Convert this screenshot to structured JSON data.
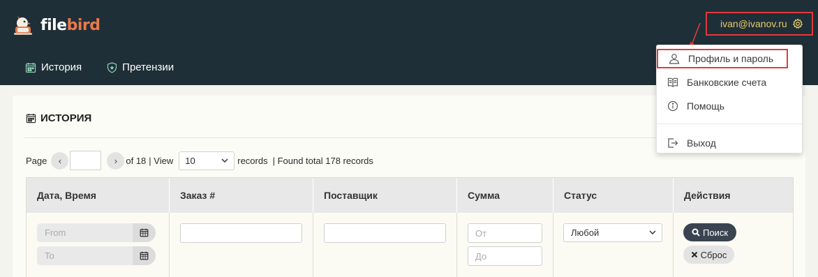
{
  "brand": {
    "logo_part1": "file",
    "logo_part2": "bird"
  },
  "user": {
    "email": "ivan@ivanov.ru"
  },
  "nav": [
    {
      "label": "История",
      "icon": "calendar-icon"
    },
    {
      "label": "Претензии",
      "icon": "shield-icon"
    }
  ],
  "user_menu": [
    {
      "label": "Профиль и пароль",
      "icon": "user-icon"
    },
    {
      "label": "Банковские счета",
      "icon": "book-icon"
    },
    {
      "label": "Помощь",
      "icon": "info-icon"
    },
    {
      "label": "Выход",
      "icon": "logout-icon"
    }
  ],
  "section": {
    "title": "ИСТОРИЯ"
  },
  "pager": {
    "page_label": "Page",
    "page_value": "",
    "of_label": "of 18",
    "view_label": "| View",
    "per_page": "10",
    "records_label": "records",
    "found_label": "| Found total 178 records"
  },
  "table": {
    "columns": [
      "Дата, Время",
      "Заказ #",
      "Поставщик",
      "Сумма",
      "Статус",
      "Действия"
    ],
    "filters": {
      "date_from_placeholder": "From",
      "date_to_placeholder": "To",
      "sum_from_placeholder": "От",
      "sum_to_placeholder": "До",
      "status_value": "Любой",
      "search_label": "Поиск",
      "reset_label": "Сброс"
    }
  },
  "colors": {
    "header_bg": "#1f2f37",
    "accent_yellow": "#e7c96b",
    "brand_orange": "#e9784c",
    "highlight_red": "#e23a3a"
  }
}
